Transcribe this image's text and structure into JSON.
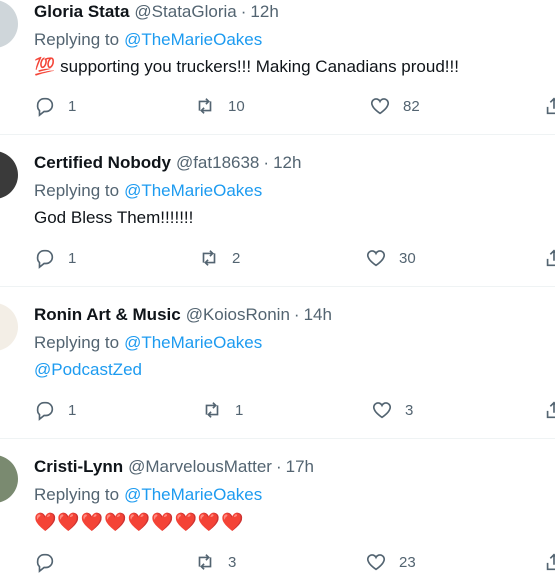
{
  "tweets": [
    {
      "name": "Gloria Stata",
      "handle": "@StataGloria",
      "time": "12h",
      "replying_label": "Replying to",
      "replying_to": "@TheMarieOakes",
      "emoji": "💯",
      "text": "supporting you truckers!!!  Making Canadians proud!!!",
      "replies": "1",
      "retweets": "10",
      "likes": "82"
    },
    {
      "name": "Certified Nobody",
      "handle": "@fat18638",
      "time": "12h",
      "replying_label": "Replying to",
      "replying_to": "@TheMarieOakes",
      "text": "God Bless Them!!!!!!!",
      "replies": "1",
      "retweets": "2",
      "likes": "30"
    },
    {
      "name": "Ronin Art & Music",
      "handle": "@KoiosRonin",
      "time": "14h",
      "replying_label": "Replying to",
      "replying_to": "@TheMarieOakes",
      "text": "@PodcastZed",
      "replies": "1",
      "retweets": "1",
      "likes": "3"
    },
    {
      "name": "Cristi-Lynn",
      "handle": "@MarvelousMatter",
      "time": "17h",
      "replying_label": "Replying to",
      "replying_to": "@TheMarieOakes",
      "text": "❤️❤️❤️❤️❤️❤️❤️❤️❤️",
      "replies": "",
      "retweets": "3",
      "likes": "23"
    }
  ],
  "separator": "·",
  "icons": {
    "reply": "reply-icon",
    "retweet": "retweet-icon",
    "like": "heart-icon",
    "share": "share-icon"
  },
  "colors": {
    "mention": "#1d9bf0",
    "muted": "#536471",
    "divider": "#eff3f4"
  }
}
